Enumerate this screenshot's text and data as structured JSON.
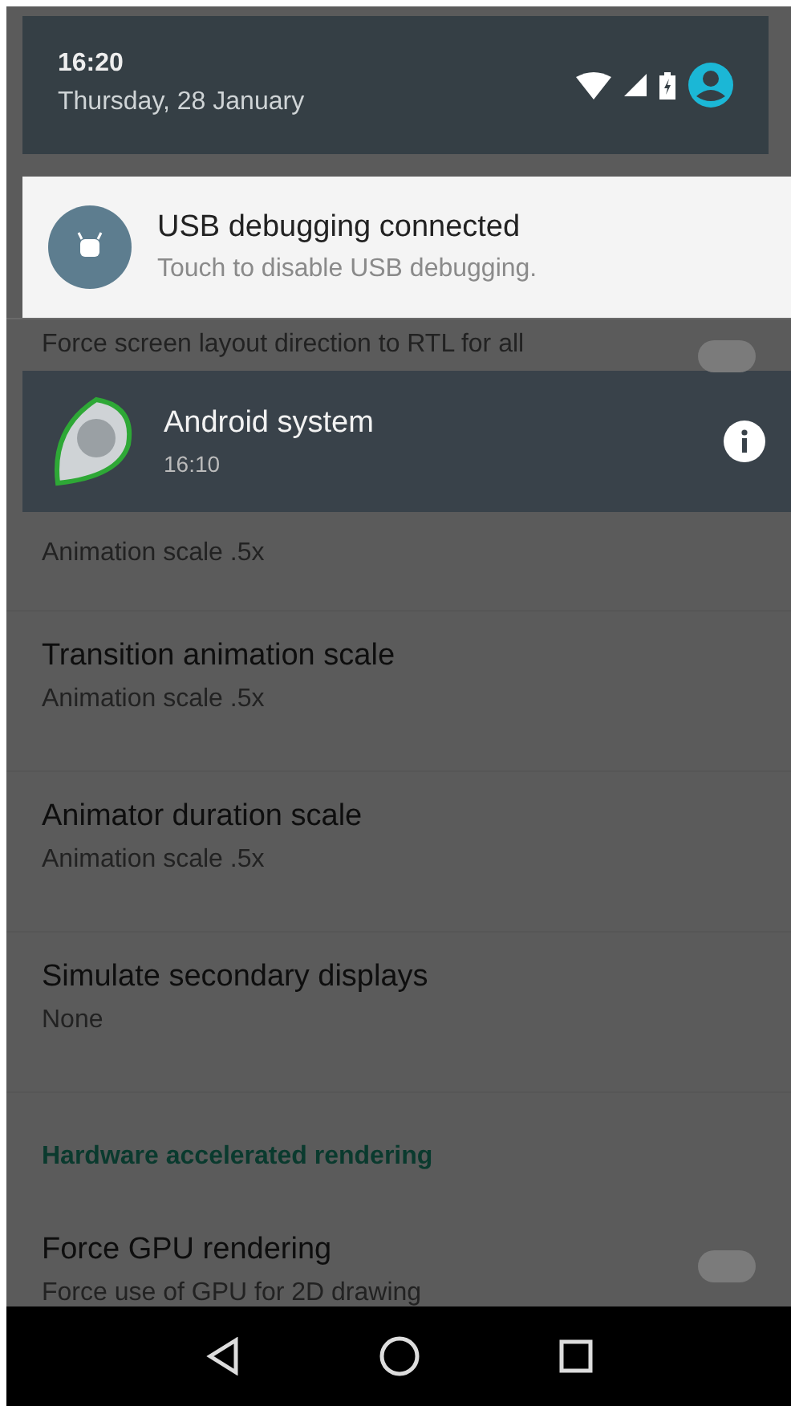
{
  "status_header": {
    "time": "16:20",
    "date": "Thursday, 28 January"
  },
  "notifications": [
    {
      "kind": "light",
      "title": "USB debugging connected",
      "text": "Touch to disable USB debugging."
    },
    {
      "kind": "dark",
      "title": "Android system",
      "text": "16:10"
    }
  ],
  "settings": [
    {
      "kind": "strip",
      "subtitle": "Force screen layout direction to RTL for all",
      "checked": false
    },
    {
      "kind": "row",
      "subtitle": "Animation scale .5x"
    },
    {
      "kind": "row",
      "title": "Transition animation scale",
      "subtitle": "Animation scale .5x"
    },
    {
      "kind": "row",
      "title": "Animator duration scale",
      "subtitle": "Animation scale .5x"
    },
    {
      "kind": "row",
      "title": "Simulate secondary displays",
      "subtitle": "None"
    },
    {
      "kind": "header",
      "title": "Hardware accelerated rendering"
    },
    {
      "kind": "row",
      "title": "Force GPU rendering",
      "subtitle": "Force use of GPU for 2D drawing",
      "checked": false
    }
  ]
}
